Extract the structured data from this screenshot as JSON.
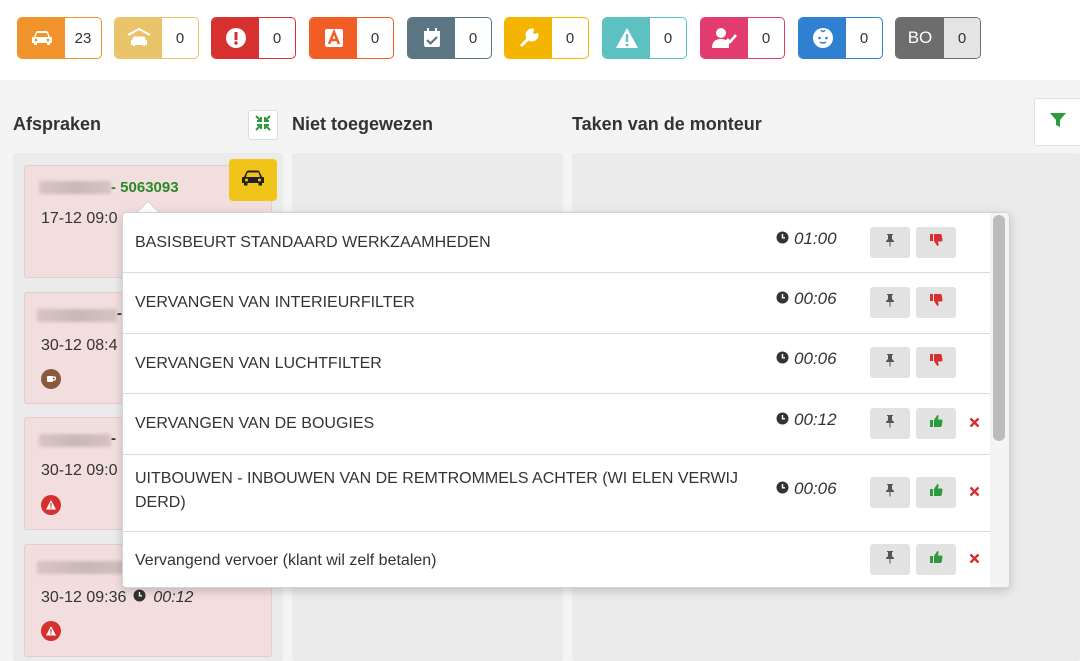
{
  "badges": [
    {
      "icon": "car-icon",
      "count": "23",
      "color": "#f0932b"
    },
    {
      "icon": "garage-car-icon",
      "count": "0",
      "color": "#e9c46a"
    },
    {
      "icon": "exclamation-circle-icon",
      "count": "0",
      "color": "#d63031"
    },
    {
      "icon": "letter-a-icon",
      "count": "0",
      "color": "#f25c25"
    },
    {
      "icon": "calendar-check-icon",
      "count": "0",
      "color": "#5b7582"
    },
    {
      "icon": "wrench-icon",
      "count": "0",
      "color": "#f4b400"
    },
    {
      "icon": "warning-icon",
      "count": "0",
      "color": "#5ec1c1"
    },
    {
      "icon": "user-check-icon",
      "count": "0",
      "color": "#e23b6f"
    },
    {
      "icon": "baby-face-icon",
      "count": "0",
      "color": "#2f80d1"
    },
    {
      "icon": "bo-text",
      "label": "BO",
      "count": "0",
      "color": "#6d6d6d"
    }
  ],
  "columns": {
    "appointments": "Afspraken",
    "unassigned": "Niet toegewezen",
    "mechanic_tasks": "Taken van de monteur"
  },
  "appointments": [
    {
      "number": "- 5063093",
      "date": "17-12 09:0",
      "status_icon": "car-icon"
    },
    {
      "number": "-",
      "date": "30-12 08:4",
      "status_icon": "coffee-icon"
    },
    {
      "number": "-",
      "date": "30-12 09:0",
      "status_icon": "warning-icon"
    },
    {
      "number": "",
      "date": "30-12 09:36",
      "time": "00:12",
      "status_icon": "warning-icon"
    }
  ],
  "tasks": [
    {
      "name": "BASISBEURT STANDAARD WERKZAAMHEDEN",
      "duration": "01:00",
      "approved": false,
      "deletable": false
    },
    {
      "name": "VERVANGEN VAN INTERIEURFILTER",
      "duration": "00:06",
      "approved": false,
      "deletable": false
    },
    {
      "name": "VERVANGEN VAN LUCHTFILTER",
      "duration": "00:06",
      "approved": false,
      "deletable": false
    },
    {
      "name": "VERVANGEN VAN DE BOUGIES",
      "duration": "00:12",
      "approved": true,
      "deletable": true
    },
    {
      "name": "UITBOUWEN - INBOUWEN VAN DE REMTROMMELS ACHTER (WI ELEN VERWIJ DERD)",
      "duration": "00:06",
      "approved": true,
      "deletable": true
    },
    {
      "name": "Vervangend vervoer (klant wil zelf betalen)",
      "duration": "",
      "approved": true,
      "deletable": true
    }
  ],
  "colors": {
    "green": "#2a8a2a",
    "red": "#d63031",
    "yellow": "#f0c419"
  }
}
